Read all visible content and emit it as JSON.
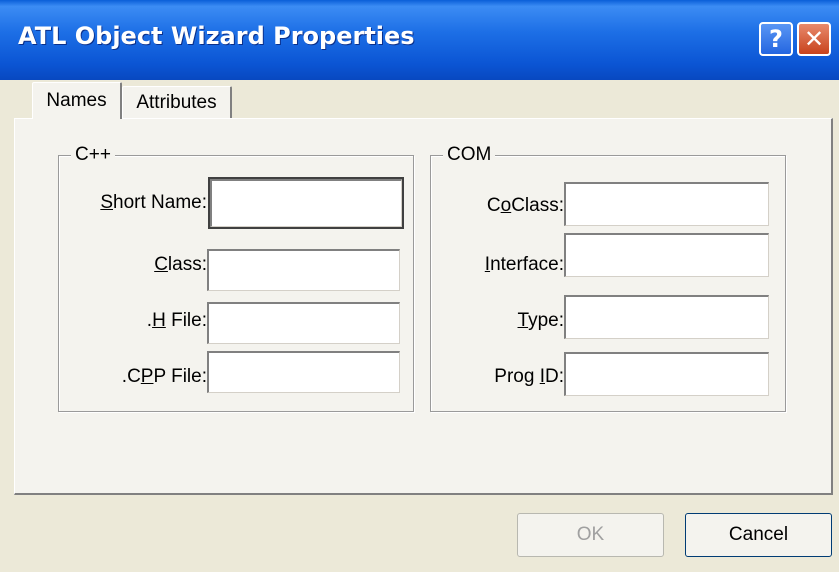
{
  "window": {
    "title": "ATL Object Wizard Properties",
    "help_glyph": "?",
    "close_glyph": "✕"
  },
  "tabs": [
    {
      "label": "Names",
      "selected": true
    },
    {
      "label": "Attributes",
      "selected": false
    }
  ],
  "cpp_group": {
    "label": "C++",
    "fields": [
      {
        "label_pre": "",
        "label_key": "S",
        "label_post": "hort Name:",
        "value": ""
      },
      {
        "label_pre": "",
        "label_key": "C",
        "label_post": "lass:",
        "value": ""
      },
      {
        "label_pre": ".",
        "label_key": "H",
        "label_post": " File:",
        "value": ""
      },
      {
        "label_pre": ".C",
        "label_key": "P",
        "label_post": "P File:",
        "value": ""
      }
    ]
  },
  "com_group": {
    "label": "COM",
    "fields": [
      {
        "label_pre": "C",
        "label_key": "o",
        "label_post": "Class:",
        "value": ""
      },
      {
        "label_pre": "",
        "label_key": "I",
        "label_post": "nterface:",
        "value": ""
      },
      {
        "label_pre": "",
        "label_key": "T",
        "label_post": "ype:",
        "value": ""
      },
      {
        "label_pre": "Prog ",
        "label_key": "I",
        "label_post": "D:",
        "value": ""
      }
    ]
  },
  "buttons": {
    "ok": "OK",
    "cancel": "Cancel"
  }
}
